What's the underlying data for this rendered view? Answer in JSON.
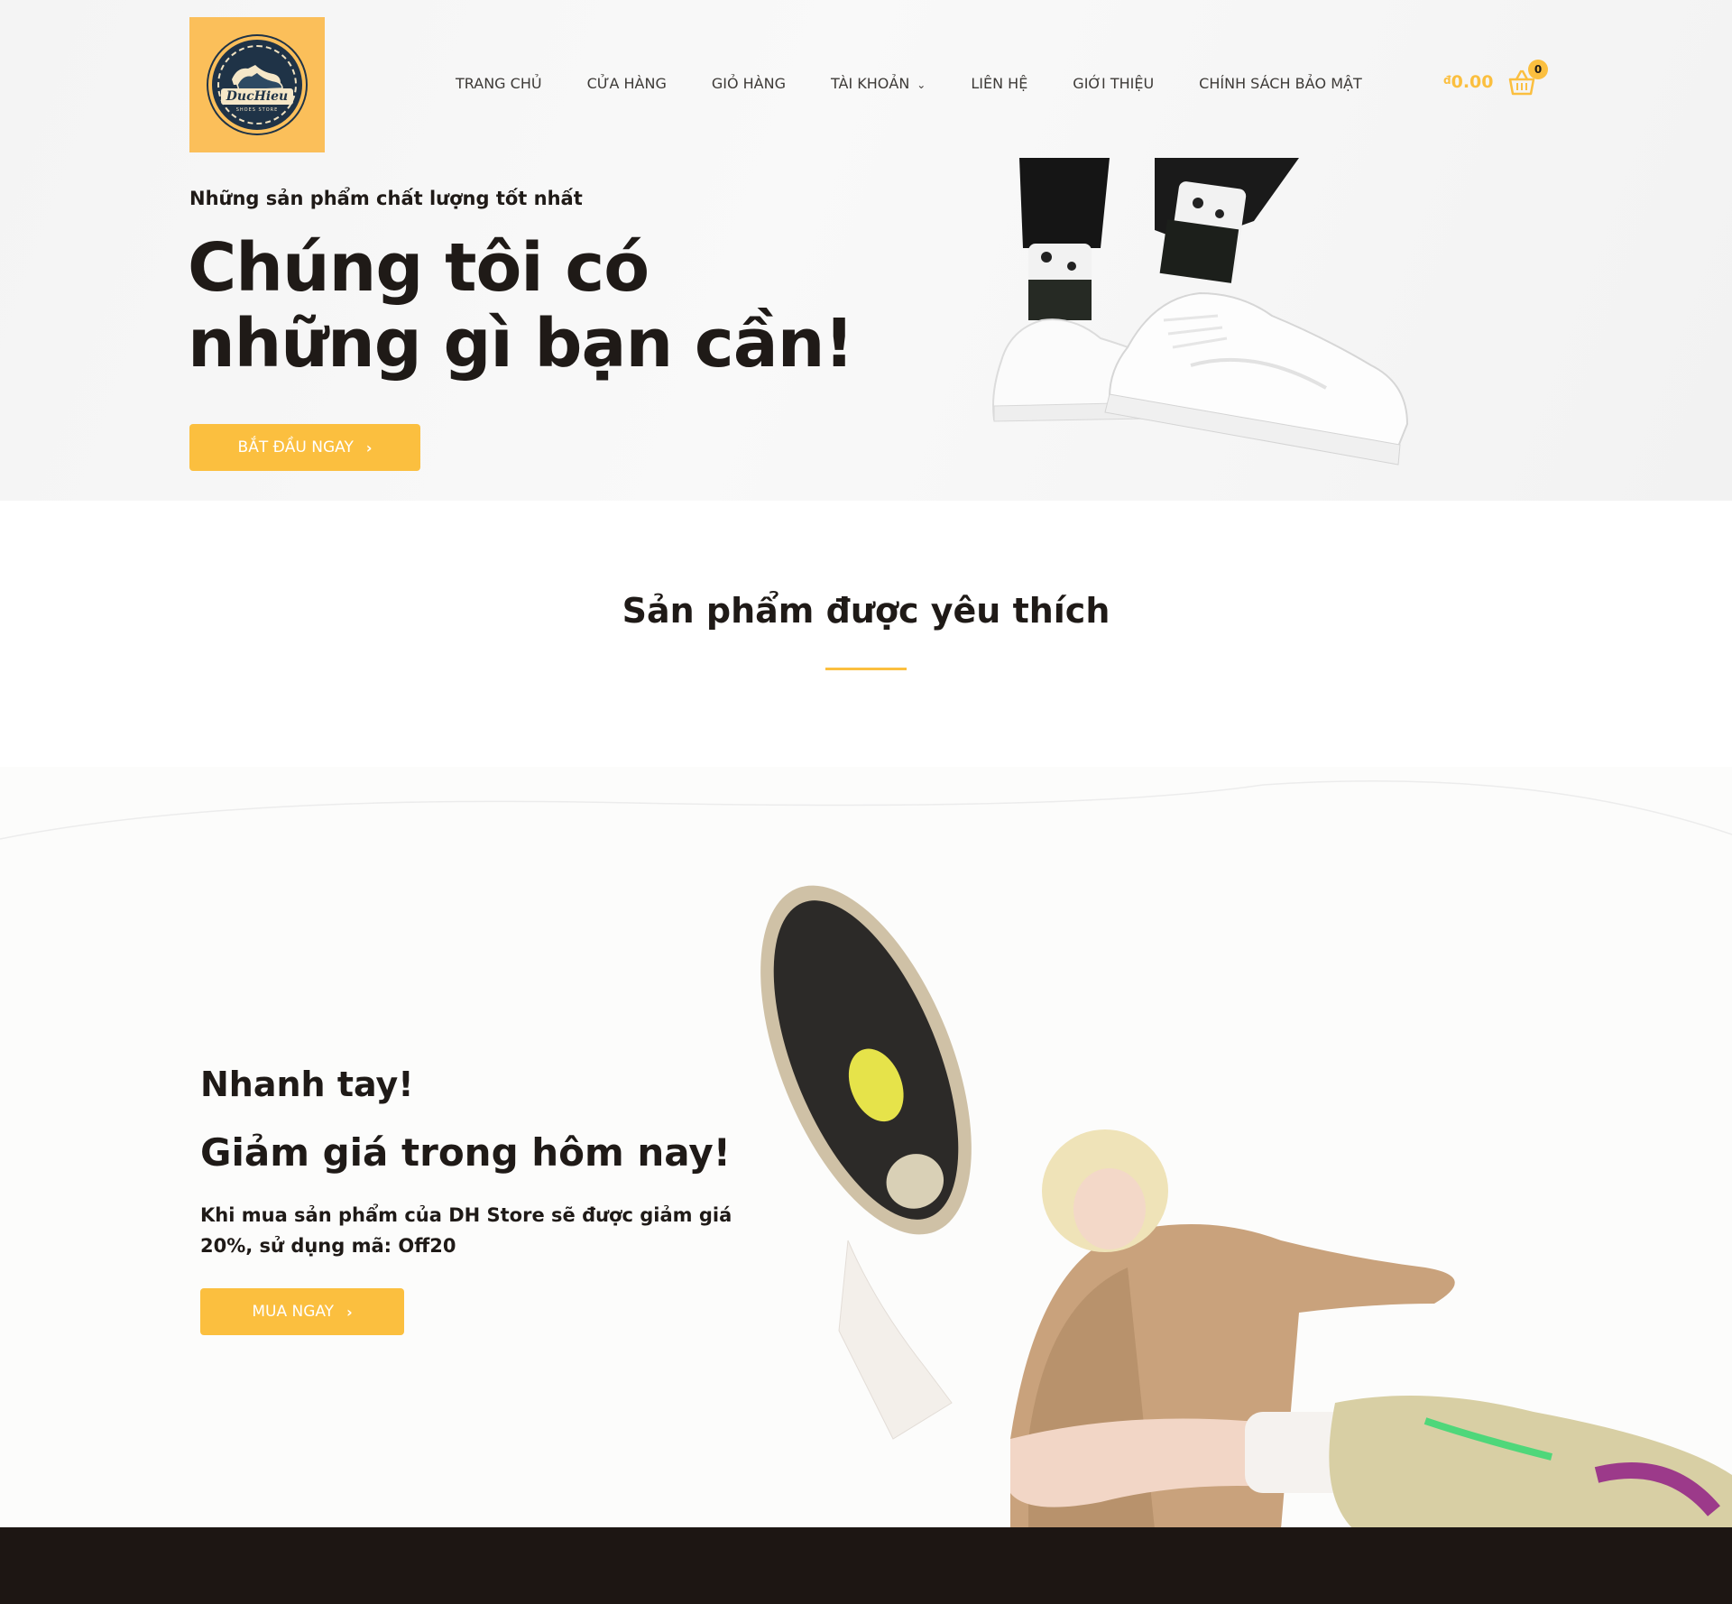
{
  "header": {
    "logo": {
      "brand": "DucHieu",
      "tagline": "SHOES STORE"
    },
    "nav": [
      {
        "label": "TRANG CHỦ"
      },
      {
        "label": "CỬA HÀNG"
      },
      {
        "label": "GIỎ HÀNG"
      },
      {
        "label": "TÀI KHOẢN",
        "has_dropdown": true
      },
      {
        "label": "LIÊN HỆ"
      },
      {
        "label": "GIỚI THIỆU"
      },
      {
        "label": "CHÍNH SÁCH BẢO MẬT"
      }
    ],
    "cart": {
      "currency": "đ",
      "amount": "0.00",
      "count": "0"
    }
  },
  "hero": {
    "kicker": "Những sản phẩm chất lượng tốt nhất",
    "title": "Chúng tôi có những gì bạn cần!",
    "button_label": "BẮT ĐẦU NGAY"
  },
  "featured": {
    "title": "Sản phẩm được yêu thích"
  },
  "promo": {
    "heading1": "Nhanh tay!",
    "heading2": "Giảm giá trong hôm nay!",
    "text": "Khi mua sản phẩm của DH Store sẽ được giảm giá 20%, sử dụng mã: Off20",
    "button_label": "MUA NGAY"
  },
  "colors": {
    "accent": "#fbbf3f",
    "text_dark": "#1f1a17",
    "footer_bg": "#1d1613",
    "logo_bg": "#fbbf5a",
    "logo_navy": "#1f3347"
  },
  "icons": {
    "nav_dropdown": "chevron-down-icon",
    "cart": "basket-icon",
    "button_arrow": "chevron-right-icon"
  }
}
